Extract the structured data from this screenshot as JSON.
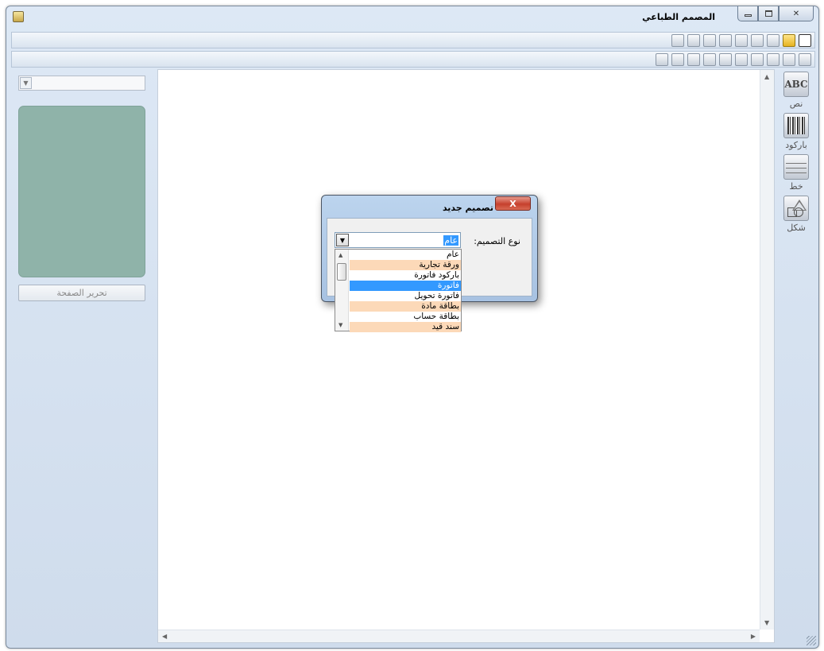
{
  "window": {
    "title": "المصمم الطباعي"
  },
  "toolbar1": {
    "buttons": [
      "new-document-icon",
      "open-folder-icon",
      "save-icon",
      "save-as-icon",
      "cut-icon",
      "copy-icon",
      "paste-icon",
      "print-icon",
      "print-preview-icon"
    ]
  },
  "toolbar2": {
    "buttons": [
      "align-left-icon",
      "align-right-icon",
      "align-top-icon",
      "align-bottom-icon",
      "center-vertical-icon",
      "center-horizontal-icon",
      "space-horizontal-icon",
      "space-vertical-icon",
      "bring-to-front-icon",
      "send-to-back-icon"
    ]
  },
  "left_panel": {
    "combo_value": "",
    "edit_page_label": "تحرير الصفحة"
  },
  "tools": [
    {
      "label": "نص",
      "icon": "ABC"
    },
    {
      "label": "باركود",
      "icon": "barcode-icon"
    },
    {
      "label": "خط",
      "icon": "line-icon"
    },
    {
      "label": "شكل",
      "icon": "shape-icon"
    }
  ],
  "dialog": {
    "title": "تصميم جديد",
    "close_label": "X",
    "field_label": "نوع التصميم:",
    "selected_value": "عام"
  },
  "dropdown": {
    "items": [
      {
        "label": "عام",
        "state": "normal"
      },
      {
        "label": "ورقة تجارية",
        "state": "alt"
      },
      {
        "label": "باركود فاتورة",
        "state": "normal"
      },
      {
        "label": "فاتورة",
        "state": "selected"
      },
      {
        "label": "فاتورة تحويل",
        "state": "normal"
      },
      {
        "label": "بطاقة مادة",
        "state": "alt"
      },
      {
        "label": "بطاقة حساب",
        "state": "normal"
      },
      {
        "label": "سند قيد",
        "state": "alt"
      }
    ]
  },
  "colors": {
    "preview_bg": "#8fb3a9",
    "selection": "#3399ff",
    "alt_row": "#fcd9b8",
    "dialog_close": "#c6402d"
  }
}
